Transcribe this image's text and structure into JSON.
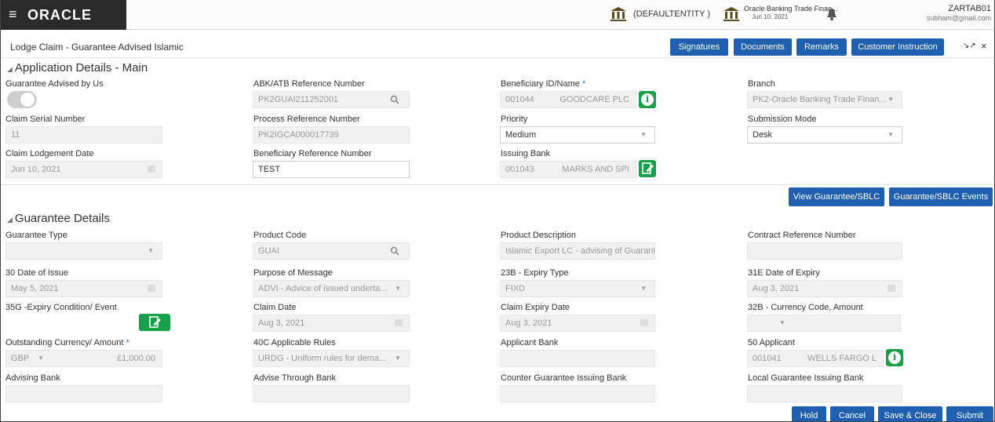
{
  "header": {
    "menu_icon": "hamburger-icon",
    "logo_text": "ORACLE",
    "entity": "(DEFAULTENTITY )",
    "bank_name": "Oracle Banking Trade Finan...",
    "bank_date": "Jun 10, 2021",
    "user_id": "ZARTAB01",
    "user_email": "subham@gmail.com"
  },
  "titlebar": {
    "title": "Lodge Claim - Guarantee Advised Islamic",
    "buttons": [
      "Signatures",
      "Documents",
      "Remarks",
      "Customer Instruction"
    ],
    "minimize_icon": "↘↗",
    "close_icon": "×"
  },
  "app_details": {
    "section_title": "Application Details - Main",
    "guarantee_advised_label": "Guarantee Advised by Us",
    "abk_label": "ABK/ATB Reference Number",
    "abk_value": "PK2GUAI211252001",
    "beneficiary_label": "Beneficiary ID/Name",
    "beneficiary_id": "001044",
    "beneficiary_name": "GOODCARE PLC",
    "branch_label": "Branch",
    "branch_value": "PK2-Oracle Banking Trade Finan...",
    "claim_serial_label": "Claim Serial Number",
    "claim_serial_value": "11",
    "process_ref_label": "Process Reference Number",
    "process_ref_value": "PK2IGCA000017739",
    "priority_label": "Priority",
    "priority_value": "Medium",
    "submission_label": "Submission Mode",
    "submission_value": "Desk",
    "lodgement_label": "Claim Lodgement Date",
    "lodgement_value": "Jun 10, 2021",
    "bene_ref_label": "Beneficiary Reference Number",
    "bene_ref_value": "TEST",
    "issuing_label": "Issuing Bank",
    "issuing_id": "001043",
    "issuing_name": "MARKS AND SPI",
    "view_button": "View Guarantee/SBLC",
    "events_button": "Guarantee/SBLC Events"
  },
  "guarantee": {
    "section_title": "Guarantee Details",
    "type_label": "Guarantee Type",
    "product_code_label": "Product Code",
    "product_code_value": "GUAI",
    "product_desc_label": "Product Description",
    "product_desc_value": "Islamic Export LC - advising of Guarant",
    "contract_ref_label": "Contract Reference Number",
    "issue_date_label": "30 Date of Issue",
    "issue_date_value": "May 5, 2021",
    "purpose_label": "Purpose of Message",
    "purpose_value": "ADVI - Advice of issued underta...",
    "expiry_type_label": "23B - Expiry Type",
    "expiry_type_value": "FIXD",
    "expiry_date_label": "31E Date of Expiry",
    "expiry_date_value": "Aug 3, 2021",
    "expiry_cond_label": "35G -Expiry Condition/ Event",
    "claim_date_label": "Claim Date",
    "claim_date_value": "Aug 3, 2021",
    "claim_expiry_label": "Claim Expiry Date",
    "claim_expiry_value": "Aug 3, 2021",
    "currency_label": "32B - Currency Code, Amount",
    "outstanding_label": "Outstanding Currency/ Amount",
    "outstanding_ccy": "GBP",
    "outstanding_amt": "£1,000.00",
    "rules_label": "40C Applicable Rules",
    "rules_value": "URDG - Uniform rules for dema...",
    "applicant_bank_label": "Applicant Bank",
    "applicant_label": "50 Applicant",
    "applicant_id": "001041",
    "applicant_name": "WELLS FARGO L",
    "advising_label": "Advising Bank",
    "advise_through_label": "Advise Through Bank",
    "counter_label": "Counter Guarantee Issuing Bank",
    "local_label": "Local Guarantee Issuing Bank"
  },
  "footer": {
    "hold": "Hold",
    "cancel": "Cancel",
    "save_close": "Save & Close",
    "submit": "Submit"
  },
  "required_mark": "*"
}
